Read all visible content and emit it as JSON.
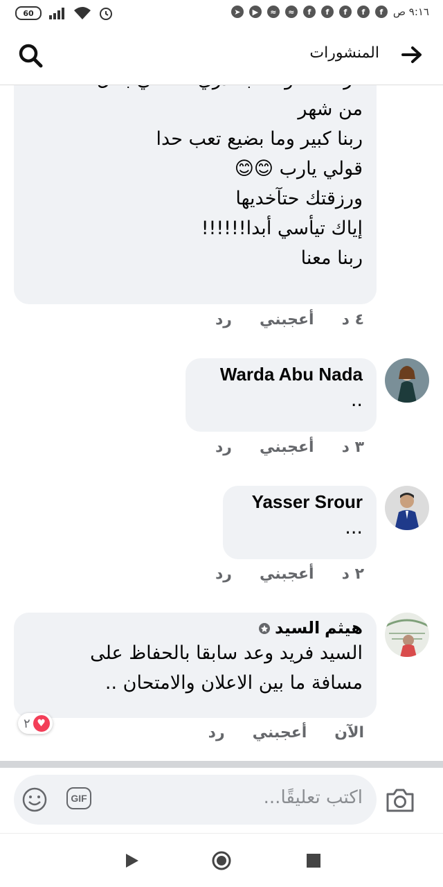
{
  "status_bar": {
    "time": "٩:١٦ ص",
    "battery": "60",
    "notification_icons": [
      "facebook-icon",
      "facebook-icon",
      "facebook-icon",
      "facebook-icon",
      "facebook-icon",
      "messenger-icon",
      "messenger-icon",
      "youtube-icon",
      "telegram-icon"
    ]
  },
  "header": {
    "title": "المنشورات"
  },
  "comments": [
    {
      "text": "فرصة ،، والله بتقدري تخلصي بأقل\nمن شهر\nربنا كبير وما بضيع تعب حدا\nقولي يارب 😊😊\nورزقتك حتآخديها\nإياك تيأسي أبدا!!!!!!\nربنا معنا",
      "time": "٤ د",
      "like": "أعجبني",
      "reply": "رد"
    },
    {
      "name": "Warda Abu Nada",
      "text": "..",
      "time": "٣ د",
      "like": "أعجبني",
      "reply": "رد"
    },
    {
      "name": "Yasser Srour",
      "text": "...",
      "time": "٢ د",
      "like": "أعجبني",
      "reply": "رد"
    },
    {
      "name": "هيثم السيد",
      "text": "السيد فريد  وعد سابقا بالحفاظ على\nمسافة ما بين الاعلان والامتحان ..",
      "time": "الآن",
      "like": "أعجبني",
      "reply": "رد",
      "reaction_count": "٢"
    }
  ],
  "composer": {
    "placeholder": "اكتب تعليقًا...",
    "gif_label": "GIF"
  },
  "colors": {
    "bubble": "#f0f2f5",
    "meta": "#65676b",
    "heart": "#f33e58"
  }
}
